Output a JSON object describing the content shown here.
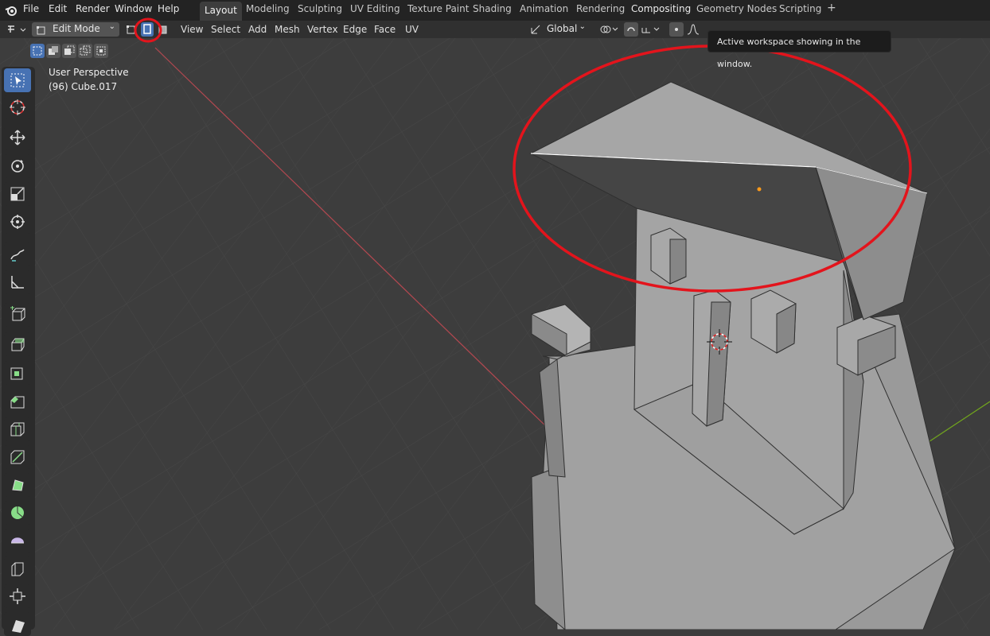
{
  "menu": [
    "File",
    "Edit",
    "Render",
    "Window",
    "Help"
  ],
  "workspaces": {
    "active_index": 0,
    "tabs": [
      "Layout",
      "Modeling",
      "Sculpting",
      "UV Editing",
      "Texture Paint",
      "Shading",
      "Animation",
      "Rendering",
      "Compositing",
      "Geometry Nodes",
      "Scripting"
    ],
    "add_label": "+"
  },
  "header": {
    "mode": "Edit Mode",
    "menus": [
      "View",
      "Select",
      "Add",
      "Mesh",
      "Vertex",
      "Edge",
      "Face",
      "UV"
    ],
    "orientation": "Global"
  },
  "viewport": {
    "view_name": "User Perspective",
    "object_name": "(96) Cube.017"
  },
  "tooltip": "Active workspace showing in the window.",
  "colors": {
    "accent": "#4772b3",
    "annotation": "#e3141c",
    "x_axis": "#b34850",
    "y_axis": "#72a81b",
    "grid": "#464646"
  },
  "icons": [
    "blender-logo-icon",
    "select-box-icon",
    "cursor-icon",
    "move-icon",
    "rotate-icon",
    "scale-icon",
    "transform-icon",
    "annotate-icon",
    "measure-icon",
    "add-cube-icon",
    "extrude-icon",
    "inset-icon",
    "bevel-icon",
    "loop-cut-icon",
    "knife-icon",
    "poly-build-icon",
    "spin-icon",
    "smooth-icon",
    "edge-slide-icon",
    "shrink-fatten-icon",
    "shear-icon"
  ]
}
